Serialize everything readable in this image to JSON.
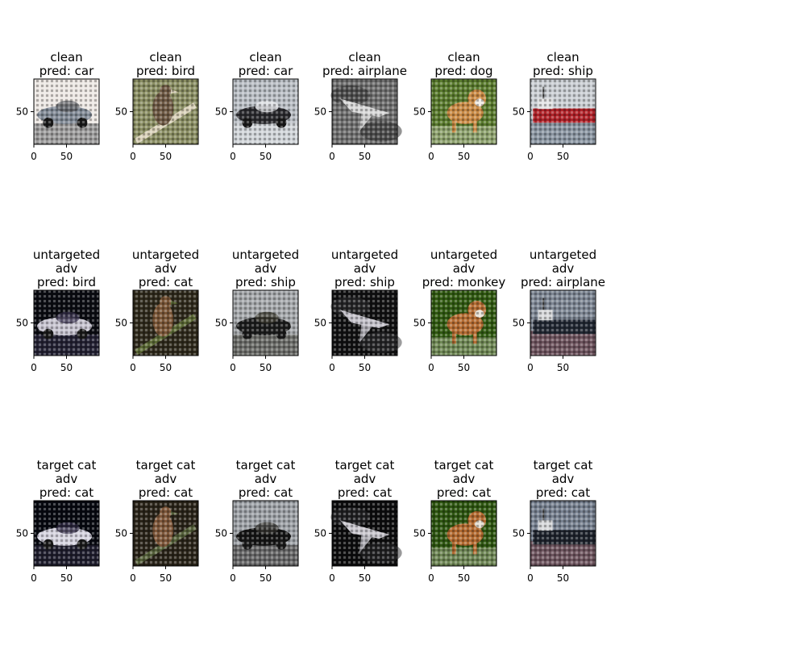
{
  "chart_data": {
    "type": "image_grid",
    "rows": [
      {
        "row_label": "clean",
        "panels": [
          {
            "title": [
              "clean",
              " pred: car"
            ],
            "subject": "car",
            "palette": [
              "#ece7e3",
              "#808995",
              "#5c5f63"
            ]
          },
          {
            "title": [
              "clean",
              " pred: bird"
            ],
            "subject": "bird",
            "palette": [
              "#8a8e63",
              "#6f5a45",
              "#d8d0b8"
            ]
          },
          {
            "title": [
              "clean",
              " pred: car"
            ],
            "subject": "car",
            "palette": [
              "#b9bec4",
              "#2b2b2f",
              "#e3e5e9"
            ]
          },
          {
            "title": [
              "clean",
              " pred: airplane"
            ],
            "subject": "airplane",
            "palette": [
              "#6f6f6f",
              "#d7d7d7",
              "#2a2a2a"
            ]
          },
          {
            "title": [
              "clean",
              " pred: dog"
            ],
            "subject": "dog",
            "palette": [
              "#5a7b2e",
              "#c98a45",
              "#f0ece6"
            ]
          },
          {
            "title": [
              "clean",
              " pred: ship"
            ],
            "subject": "ship",
            "palette": [
              "#c9cdd2",
              "#b0232a",
              "#7c8896"
            ]
          }
        ]
      },
      {
        "row_label": "untargeted adv",
        "panels": [
          {
            "title": [
              "untargeted",
              "adv",
              " pred: bird"
            ],
            "subject": "car",
            "palette": [
              "#0b0c12",
              "#c6c3cf",
              "#3b3550"
            ]
          },
          {
            "title": [
              "untargeted",
              "adv",
              " pred: cat"
            ],
            "subject": "bird",
            "palette": [
              "#2f2a1c",
              "#7a5637",
              "#5c6a36"
            ]
          },
          {
            "title": [
              "untargeted",
              "adv",
              " pred: ship"
            ],
            "subject": "car",
            "palette": [
              "#a5a8ab",
              "#1c1d1d",
              "#3e3d33"
            ]
          },
          {
            "title": [
              "untargeted",
              "adv",
              " pred: ship"
            ],
            "subject": "airplane",
            "palette": [
              "#111112",
              "#c3c1c9",
              "#3a3a3c"
            ]
          },
          {
            "title": [
              "untargeted",
              "adv",
              " pred: monkey"
            ],
            "subject": "dog",
            "palette": [
              "#315a12",
              "#b56d33",
              "#e7e1d6"
            ]
          },
          {
            "title": [
              "untargeted",
              "adv",
              "pred: airplane"
            ],
            "subject": "ship",
            "palette": [
              "#7e8794",
              "#222833",
              "#6a4750"
            ]
          }
        ]
      },
      {
        "row_label": "target cat adv",
        "panels": [
          {
            "title": [
              "target cat",
              "adv",
              " pred: cat"
            ],
            "subject": "car",
            "palette": [
              "#070910",
              "#d4d2de",
              "#322d46"
            ]
          },
          {
            "title": [
              "target cat",
              "adv",
              " pred: cat"
            ],
            "subject": "bird",
            "palette": [
              "#2a2419",
              "#7e573a",
              "#55603a"
            ]
          },
          {
            "title": [
              "target cat",
              "adv",
              " pred: cat"
            ],
            "subject": "car",
            "palette": [
              "#9da1a6",
              "#151515",
              "#3a3834"
            ]
          },
          {
            "title": [
              "target cat",
              "adv",
              " pred: cat"
            ],
            "subject": "airplane",
            "palette": [
              "#0d0d0e",
              "#c7c5cc",
              "#333335"
            ]
          },
          {
            "title": [
              "target cat",
              "adv",
              " pred: cat"
            ],
            "subject": "dog",
            "palette": [
              "#2e5611",
              "#b26a30",
              "#e5dfd4"
            ]
          },
          {
            "title": [
              "target cat",
              "adv",
              " pred: cat"
            ],
            "subject": "ship",
            "palette": [
              "#778190",
              "#1e232c",
              "#6b4a52"
            ]
          }
        ]
      }
    ],
    "x_ticks": [
      0,
      50
    ],
    "y_ticks": [
      50
    ],
    "xlim": [
      0,
      100
    ],
    "ylim": [
      100,
      0
    ],
    "grid": false
  }
}
